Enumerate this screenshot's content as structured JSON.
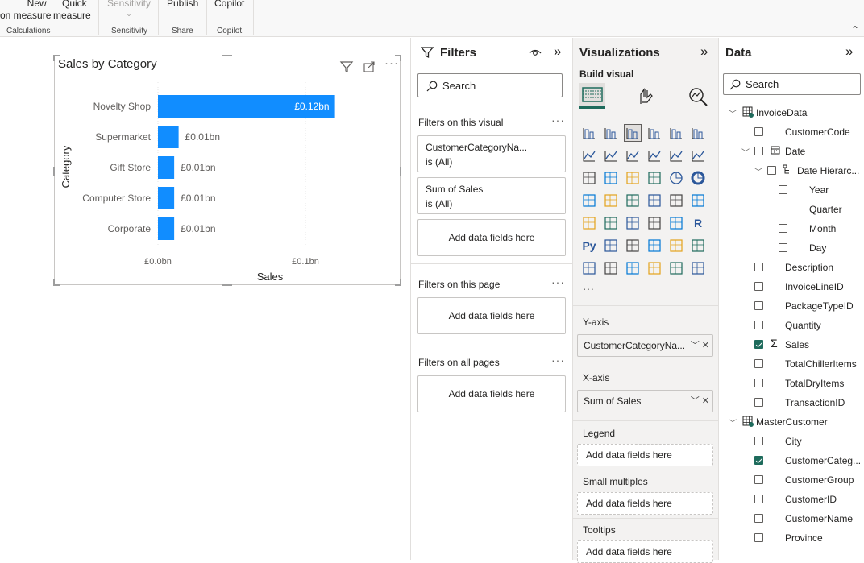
{
  "ribbon": {
    "new_measure": "New",
    "new_measure_2": "on measure",
    "quick_measure": "Quick",
    "quick_measure_2": "measure",
    "sensitivity": "Sensitivity",
    "publish": "Publish",
    "copilot": "Copilot",
    "groups": {
      "calculations": "Calculations",
      "sensitivity": "Sensitivity",
      "share": "Share",
      "copilot": "Copilot"
    }
  },
  "visual": {
    "title": "Sales by Category"
  },
  "chart_data": {
    "type": "bar",
    "title": "Sales by Category",
    "categories": [
      "Novelty Shop",
      "Supermarket",
      "Gift Store",
      "Computer Store",
      "Corporate"
    ],
    "values": [
      0.12,
      0.014,
      0.011,
      0.011,
      0.011
    ],
    "data_labels": [
      "£0.12bn",
      "£0.01bn",
      "£0.01bn",
      "£0.01bn",
      "£0.01bn"
    ],
    "xlabel": "Sales",
    "ylabel": "Category",
    "xticks": [
      "£0.0bn",
      "£0.1bn"
    ],
    "xlim": [
      0,
      0.1
    ],
    "bar_color": "#118dff",
    "grid": true
  },
  "filters": {
    "title": "Filters",
    "search_placeholder": "Search",
    "on_visual": "Filters on this visual",
    "cards": [
      {
        "line1": "CustomerCategoryNa...",
        "line2": "is (All)"
      },
      {
        "line1": "Sum of Sales",
        "line2": "is (All)"
      }
    ],
    "add_fields": "Add data fields here",
    "on_page": "Filters on this page",
    "on_all": "Filters on all pages"
  },
  "viz": {
    "title": "Visualizations",
    "build_visual": "Build visual",
    "more": "...",
    "wells": {
      "yaxis_label": "Y-axis",
      "yaxis_value": "CustomerCategoryNa...",
      "xaxis_label": "X-axis",
      "xaxis_value": "Sum of Sales",
      "legend_label": "Legend",
      "small_multiples_label": "Small multiples",
      "tooltips_label": "Tooltips",
      "add_fields": "Add data fields here"
    }
  },
  "data": {
    "title": "Data",
    "search_placeholder": "Search",
    "tables": {
      "invoice": "InvoiceData",
      "customer_code": "CustomerCode",
      "date": "Date",
      "date_hierarchy": "Date Hierarc...",
      "year": "Year",
      "quarter": "Quarter",
      "month": "Month",
      "day": "Day",
      "description": "Description",
      "invoice_line_id": "InvoiceLineID",
      "package_type_id": "PackageTypeID",
      "quantity": "Quantity",
      "sales": "Sales",
      "total_chiller": "TotalChillerItems",
      "total_dry": "TotalDryItems",
      "transaction_id": "TransactionID",
      "master_customer": "MasterCustomer",
      "city": "City",
      "customer_categ": "CustomerCateg...",
      "customer_group": "CustomerGroup",
      "customer_id": "CustomerID",
      "customer_name": "CustomerName",
      "province": "Province"
    }
  }
}
